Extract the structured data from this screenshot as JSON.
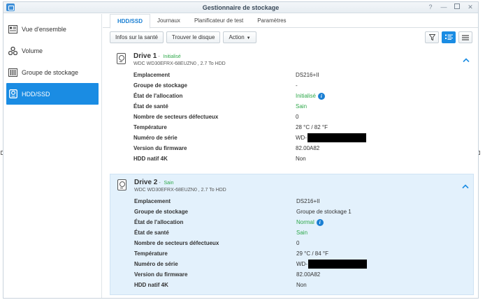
{
  "window": {
    "title": "Gestionnaire de stockage"
  },
  "sidebar": {
    "items": [
      {
        "label": "Vue d'ensemble",
        "icon": "overview-icon",
        "active": false
      },
      {
        "label": "Volume",
        "icon": "volume-icon",
        "active": false
      },
      {
        "label": "Groupe de stockage",
        "icon": "storage-pool-icon",
        "active": false
      },
      {
        "label": "HDD/SSD",
        "icon": "hdd-icon",
        "active": true
      }
    ]
  },
  "tabs": [
    {
      "label": "HDD/SSD",
      "active": true
    },
    {
      "label": "Journaux",
      "active": false
    },
    {
      "label": "Planificateur de test",
      "active": false
    },
    {
      "label": "Paramètres",
      "active": false
    }
  ],
  "toolbar": {
    "health_info": "Infos sur la santé",
    "find_disk": "Trouver le disque",
    "action": "Action"
  },
  "drives": [
    {
      "name": "Drive 1",
      "dash": "-",
      "status": "Initialisé",
      "model": "WDC WD30EFRX-68EUZN0 , 2.7 To HDD",
      "rows": [
        {
          "key": "Emplacement",
          "value": "DS216+II"
        },
        {
          "key": "Groupe de stockage",
          "value": "-"
        },
        {
          "key": "État de l'allocation",
          "value": "Initialisé"
        },
        {
          "key": "État de santé",
          "value": "Sain"
        },
        {
          "key": "Nombre de secteurs défectueux",
          "value": "0"
        },
        {
          "key": "Température",
          "value": "28 °C / 82 °F"
        },
        {
          "key": "Numéro de série",
          "value": "WD-"
        },
        {
          "key": "Version du firmware",
          "value": "82.00A82"
        },
        {
          "key": "HDD natif 4K",
          "value": "Non"
        }
      ]
    },
    {
      "name": "Drive 2",
      "dash": "-",
      "status": "Sain",
      "model": "WDC WD30EFRX-68EUZN0 , 2.7 To HDD",
      "rows": [
        {
          "key": "Emplacement",
          "value": "DS216+II"
        },
        {
          "key": "Groupe de stockage",
          "value": "Groupe de stockage 1"
        },
        {
          "key": "État de l'allocation",
          "value": "Normal"
        },
        {
          "key": "État de santé",
          "value": "Sain"
        },
        {
          "key": "Nombre de secteurs défectueux",
          "value": "0"
        },
        {
          "key": "Température",
          "value": "29 °C / 84 °F"
        },
        {
          "key": "Numéro de série",
          "value": "WD-"
        },
        {
          "key": "Version du firmware",
          "value": "82.00A82"
        },
        {
          "key": "HDD natif 4K",
          "value": "Non"
        }
      ]
    }
  ],
  "colors": {
    "accent": "#1a8ce3",
    "success": "#2ea84a",
    "selected_bg": "#e3f1fc"
  }
}
